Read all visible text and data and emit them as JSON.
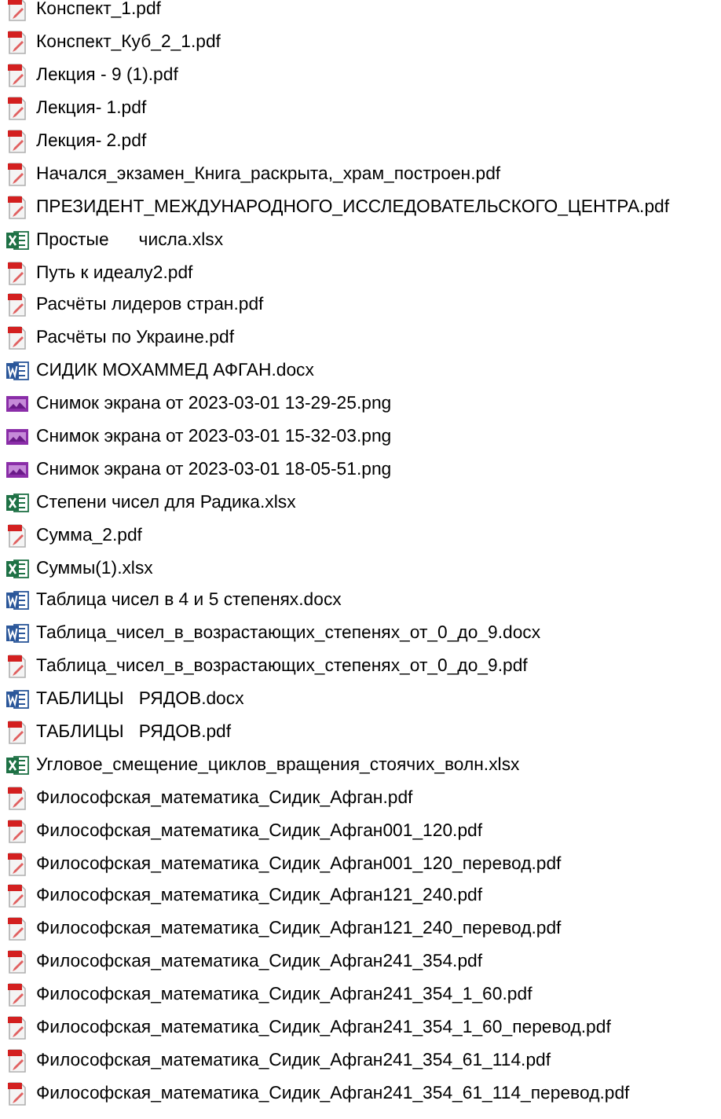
{
  "files": [
    {
      "name": "Конспект_1.pdf",
      "kind": "pdf"
    },
    {
      "name": "Конспект_Куб_2_1.pdf",
      "kind": "pdf"
    },
    {
      "name": "Лекция - 9 (1).pdf",
      "kind": "pdf"
    },
    {
      "name": "Лекция- 1.pdf",
      "kind": "pdf"
    },
    {
      "name": "Лекция- 2.pdf",
      "kind": "pdf"
    },
    {
      "name": "Начался_экзамен_Книга_раскрыта,_храм_построен.pdf",
      "kind": "pdf"
    },
    {
      "name": "ПРЕЗИДЕНТ_МЕЖДУНАРОДНОГО_ИССЛЕДОВАТЕЛЬСКОГО_ЦЕНТРА.pdf",
      "kind": "pdf"
    },
    {
      "name": "Простые      числа.xlsx",
      "kind": "xlsx"
    },
    {
      "name": "Путь к идеалу2.pdf",
      "kind": "pdf"
    },
    {
      "name": "Расчёты лидеров стран.pdf",
      "kind": "pdf"
    },
    {
      "name": "Расчёты по Украине.pdf",
      "kind": "pdf"
    },
    {
      "name": "СИДИК МОХАММЕД АФГАН.docx",
      "kind": "docx"
    },
    {
      "name": "Снимок экрана от 2023-03-01 13-29-25.png",
      "kind": "png"
    },
    {
      "name": "Снимок экрана от 2023-03-01 15-32-03.png",
      "kind": "png"
    },
    {
      "name": "Снимок экрана от 2023-03-01 18-05-51.png",
      "kind": "png"
    },
    {
      "name": "Степени чисел для Радика.xlsx",
      "kind": "xlsx"
    },
    {
      "name": "Сумма_2.pdf",
      "kind": "pdf"
    },
    {
      "name": "Суммы(1).xlsx",
      "kind": "xlsx"
    },
    {
      "name": "Таблица чисел в 4 и 5 степенях.docx",
      "kind": "docx"
    },
    {
      "name": "Таблица_чисел_в_возрастающих_степенях_от_0_до_9.docx",
      "kind": "docx"
    },
    {
      "name": "Таблица_чисел_в_возрастающих_степенях_от_0_до_9.pdf",
      "kind": "pdf"
    },
    {
      "name": "ТАБЛИЦЫ   РЯДОВ.docx",
      "kind": "docx"
    },
    {
      "name": "ТАБЛИЦЫ   РЯДОВ.pdf",
      "kind": "pdf"
    },
    {
      "name": "Угловое_смещение_циклов_вращения_стоячих_волн.xlsx",
      "kind": "xlsx"
    },
    {
      "name": "Философская_математика_Сидик_Афган.pdf",
      "kind": "pdf"
    },
    {
      "name": "Философская_математика_Сидик_Афган001_120.pdf",
      "kind": "pdf"
    },
    {
      "name": "Философская_математика_Сидик_Афган001_120_перевод.pdf",
      "kind": "pdf"
    },
    {
      "name": "Философская_математика_Сидик_Афган121_240.pdf",
      "kind": "pdf"
    },
    {
      "name": "Философская_математика_Сидик_Афган121_240_перевод.pdf",
      "kind": "pdf"
    },
    {
      "name": "Философская_математика_Сидик_Афган241_354.pdf",
      "kind": "pdf"
    },
    {
      "name": "Философская_математика_Сидик_Афган241_354_1_60.pdf",
      "kind": "pdf"
    },
    {
      "name": "Философская_математика_Сидик_Афган241_354_1_60_перевод.pdf",
      "kind": "pdf"
    },
    {
      "name": "Философская_математика_Сидик_Афган241_354_61_114.pdf",
      "kind": "pdf"
    },
    {
      "name": "Философская_математика_Сидик_Афган241_354_61_114_перевод.pdf",
      "kind": "pdf"
    }
  ]
}
